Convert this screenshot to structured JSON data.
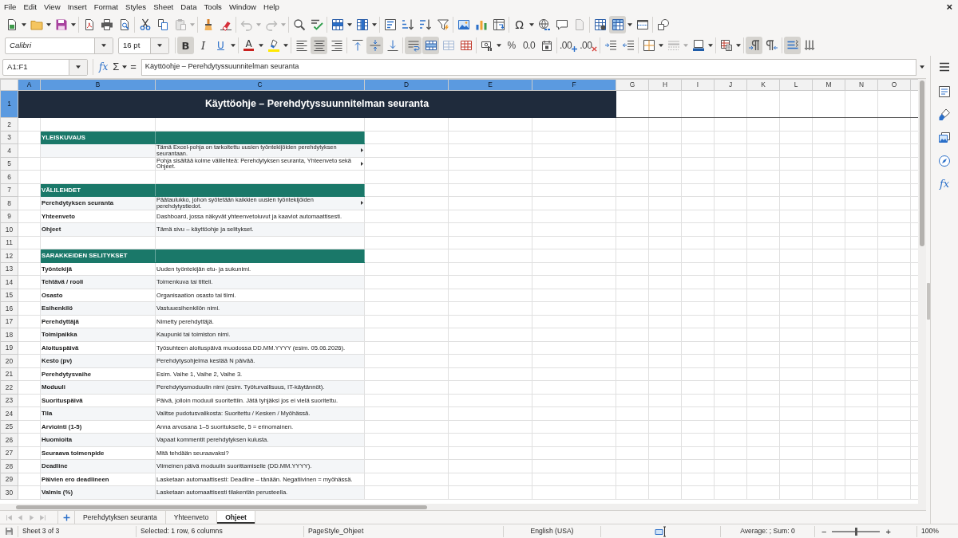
{
  "menu_bar": {
    "items": [
      "File",
      "Edit",
      "View",
      "Insert",
      "Format",
      "Styles",
      "Sheet",
      "Data",
      "Tools",
      "Window",
      "Help"
    ],
    "close": "×"
  },
  "standard_toolbar": {
    "groups": [
      [
        {
          "kind": "new",
          "dropdown": true,
          "pressed": false,
          "disabled": false
        },
        {
          "kind": "open",
          "dropdown": true,
          "pressed": false,
          "disabled": false
        },
        {
          "kind": "save",
          "dropdown": true,
          "pressed": false,
          "disabled": false
        }
      ],
      [
        {
          "kind": "pdf",
          "pressed": false,
          "disabled": false
        },
        {
          "kind": "print",
          "pressed": false,
          "disabled": false
        },
        {
          "kind": "preview",
          "pressed": false,
          "disabled": false
        }
      ],
      [
        {
          "kind": "cut",
          "pressed": false,
          "disabled": false
        },
        {
          "kind": "copy",
          "pressed": false,
          "disabled": false
        },
        {
          "kind": "paste",
          "dropdown": true,
          "pressed": false,
          "disabled": true
        }
      ],
      [
        {
          "kind": "clone",
          "pressed": false,
          "disabled": false
        },
        {
          "kind": "clear",
          "pressed": false,
          "disabled": false
        }
      ],
      [
        {
          "kind": "undo",
          "dropdown": true,
          "pressed": false,
          "disabled": true
        },
        {
          "kind": "redo",
          "dropdown": true,
          "pressed": false,
          "disabled": true
        }
      ],
      [
        {
          "kind": "find",
          "pressed": false,
          "disabled": false
        },
        {
          "kind": "spelling",
          "pressed": false,
          "disabled": false
        }
      ],
      [
        {
          "kind": "row",
          "dropdown": true,
          "pressed": false,
          "disabled": false
        },
        {
          "kind": "column",
          "dropdown": true,
          "pressed": false,
          "disabled": false
        }
      ],
      [
        {
          "kind": "sort",
          "pressed": false,
          "disabled": false
        },
        {
          "kind": "sortasc",
          "pressed": false,
          "disabled": false
        },
        {
          "kind": "sortdesc",
          "pressed": false,
          "disabled": false
        },
        {
          "kind": "filter",
          "pressed": false,
          "disabled": false
        }
      ],
      [
        {
          "kind": "image",
          "pressed": false,
          "disabled": false
        },
        {
          "kind": "chart",
          "pressed": false,
          "disabled": false
        },
        {
          "kind": "pivot",
          "pressed": false,
          "disabled": false
        }
      ],
      [
        {
          "kind": "special",
          "text": "Ω",
          "dropdown": true,
          "pressed": false,
          "disabled": false
        },
        {
          "kind": "link",
          "pressed": false,
          "disabled": false
        },
        {
          "kind": "comment",
          "pressed": false,
          "disabled": false
        },
        {
          "kind": "headerfooter",
          "pressed": false,
          "disabled": true
        }
      ],
      [
        {
          "kind": "printarea",
          "pressed": false,
          "disabled": false
        },
        {
          "kind": "freeze",
          "dropdown": true,
          "pressed": true,
          "disabled": false
        },
        {
          "kind": "split",
          "pressed": false,
          "disabled": false
        }
      ],
      [
        {
          "kind": "draw",
          "pressed": false,
          "disabled": false
        }
      ]
    ]
  },
  "formatting_toolbar": {
    "font_name": "Calibri",
    "font_size": "16 pt",
    "groups": [
      [
        {
          "kind": "bold",
          "text": "B",
          "pressed": true,
          "disabled": false
        },
        {
          "kind": "italic",
          "text": "I",
          "pressed": false,
          "disabled": false
        },
        {
          "kind": "underline",
          "text": "U",
          "dropdown": true,
          "pressed": false,
          "disabled": false
        }
      ],
      [
        {
          "kind": "fontcolor",
          "text": "A",
          "dropdown": true,
          "pressed": false,
          "disabled": false
        },
        {
          "kind": "highlight",
          "dropdown": true,
          "pressed": false,
          "disabled": false
        }
      ],
      [
        {
          "kind": "alignleft",
          "pressed": false,
          "disabled": false
        },
        {
          "kind": "aligncenter",
          "pressed": true,
          "disabled": false
        },
        {
          "kind": "alignright",
          "pressed": false,
          "disabled": false
        }
      ],
      [
        {
          "kind": "aligntop",
          "pressed": false,
          "disabled": false
        },
        {
          "kind": "alignmiddle",
          "pressed": true,
          "disabled": false
        },
        {
          "kind": "alignbottom",
          "pressed": false,
          "disabled": false
        }
      ],
      [
        {
          "kind": "wrap",
          "pressed": true,
          "disabled": false
        },
        {
          "kind": "mergecenter",
          "pressed": true,
          "disabled": false
        },
        {
          "kind": "merge",
          "pressed": false,
          "disabled": true
        },
        {
          "kind": "unmerge",
          "pressed": false,
          "disabled": false
        }
      ],
      [
        {
          "kind": "currency",
          "dropdown": true,
          "pressed": false,
          "disabled": false
        },
        {
          "kind": "percent",
          "text": "%",
          "pressed": false,
          "disabled": false
        },
        {
          "kind": "number",
          "text": "0.0",
          "pressed": false,
          "disabled": false
        },
        {
          "kind": "date",
          "pressed": false,
          "disabled": false
        }
      ],
      [
        {
          "kind": "adddec",
          "text": ".00",
          "pressed": false,
          "disabled": false
        },
        {
          "kind": "deldec",
          "text": ".00",
          "pressed": false,
          "disabled": false
        }
      ],
      [
        {
          "kind": "indent",
          "pressed": false,
          "disabled": false
        },
        {
          "kind": "outdent",
          "pressed": false,
          "disabled": false
        }
      ],
      [
        {
          "kind": "borders",
          "dropdown": true,
          "pressed": false,
          "disabled": false
        },
        {
          "kind": "borderstyle",
          "dropdown": true,
          "pressed": false,
          "disabled": true
        },
        {
          "kind": "bordercolor",
          "dropdown": true,
          "pressed": false,
          "disabled": false
        }
      ],
      [
        {
          "kind": "conditional",
          "dropdown": true,
          "pressed": false,
          "disabled": false
        }
      ],
      [
        {
          "kind": "ltr",
          "pressed": true,
          "disabled": false
        },
        {
          "kind": "rtl",
          "pressed": false,
          "disabled": false
        }
      ],
      [
        {
          "kind": "horizontal",
          "pressed": true,
          "disabled": false
        },
        {
          "kind": "vertical",
          "pressed": false,
          "disabled": false
        }
      ]
    ]
  },
  "formula_bar": {
    "name_box": "A1:F1",
    "function_wizard": "fx",
    "sum": "Σ",
    "equals": "=",
    "content": "Käyttöohje – Perehdytyssuunnitelman seuranta"
  },
  "sidebar": {
    "functions": "fx"
  },
  "columns": [
    {
      "label": "A",
      "selected": true
    },
    {
      "label": "B",
      "selected": true
    },
    {
      "label": "C",
      "selected": true
    },
    {
      "label": "D",
      "selected": true
    },
    {
      "label": "E",
      "selected": true
    },
    {
      "label": "F",
      "selected": true
    },
    {
      "label": "G",
      "selected": false
    },
    {
      "label": "H",
      "selected": false
    },
    {
      "label": "I",
      "selected": false
    },
    {
      "label": "J",
      "selected": false
    },
    {
      "label": "K",
      "selected": false
    },
    {
      "label": "L",
      "selected": false
    },
    {
      "label": "M",
      "selected": false
    },
    {
      "label": "N",
      "selected": false
    },
    {
      "label": "O",
      "selected": false
    }
  ],
  "rows": [
    {
      "number": "1",
      "selected": true,
      "kind": "title",
      "text": "Käyttöohje – Perehdytyssuunnitelman seuranta"
    },
    {
      "number": "2",
      "selected": false,
      "kind": "blank"
    },
    {
      "number": "3",
      "selected": false,
      "kind": "section",
      "label": "YLEISKUVAUS"
    },
    {
      "number": "4",
      "selected": false,
      "kind": "entry",
      "description": "Tämä Excel-pohja on tarkoitettu uusien työntekijöiden perehdytyksen seurantaan.",
      "overflow": true
    },
    {
      "number": "5",
      "selected": false,
      "kind": "entry",
      "description": "Pohja sisältää kolme välilehteä: Perehdytyksen seuranta, Yhteenveto sekä Ohjeet.",
      "overflow": true
    },
    {
      "number": "6",
      "selected": false,
      "kind": "blank"
    },
    {
      "number": "7",
      "selected": false,
      "kind": "section",
      "label": "VÄLILEHDET"
    },
    {
      "number": "8",
      "selected": false,
      "kind": "entry",
      "term": "Perehdytyksen seuranta",
      "description": "Päätaulukko, johon syötetään kaikkien uusien työntekijöiden perehdytystiedot.",
      "overflow": true
    },
    {
      "number": "9",
      "selected": false,
      "kind": "entry",
      "term": "Yhteenveto",
      "description": "Dashboard, jossa näkyvät yhteenvetoluvut ja kaaviot automaattisesti.",
      "overflow": false
    },
    {
      "number": "10",
      "selected": false,
      "kind": "entry",
      "term": "Ohjeet",
      "description": "Tämä sivu – käyttöohje ja selitykset.",
      "overflow": false
    },
    {
      "number": "11",
      "selected": false,
      "kind": "blank"
    },
    {
      "number": "12",
      "selected": false,
      "kind": "section",
      "label": "SARAKKEIDEN SELITYKSET"
    },
    {
      "number": "13",
      "selected": false,
      "kind": "entry",
      "term": "Työntekijä",
      "description": "Uuden työntekijän etu- ja sukunimi.",
      "overflow": false
    },
    {
      "number": "14",
      "selected": false,
      "kind": "entry",
      "term": "Tehtävä / rooli",
      "description": "Toimenkuva tai titteli.",
      "overflow": false
    },
    {
      "number": "15",
      "selected": false,
      "kind": "entry",
      "term": "Osasto",
      "description": "Organisaation osasto tai tiimi.",
      "overflow": false
    },
    {
      "number": "16",
      "selected": false,
      "kind": "entry",
      "term": "Esihenkilö",
      "description": "Vastuuesihenkilön nimi.",
      "overflow": false
    },
    {
      "number": "17",
      "selected": false,
      "kind": "entry",
      "term": "Perehdyttäjä",
      "description": "Nimetty perehdyttäjä.",
      "overflow": false
    },
    {
      "number": "18",
      "selected": false,
      "kind": "entry",
      "term": "Toimipaikka",
      "description": "Kaupunki tai toimiston nimi.",
      "overflow": false
    },
    {
      "number": "19",
      "selected": false,
      "kind": "entry",
      "term": "Aloituspäivä",
      "description": "Työsuhteen aloituspäivä muodossa DD.MM.YYYY (esim. 05.06.2026).",
      "overflow": false
    },
    {
      "number": "20",
      "selected": false,
      "kind": "entry",
      "term": "Kesto (pv)",
      "description": "Perehdytysohjelma kestää N päivää.",
      "overflow": false
    },
    {
      "number": "21",
      "selected": false,
      "kind": "entry",
      "term": "Perehdytysvaihe",
      "description": "Esim. Vaihe 1, Vaihe 2, Vaihe 3.",
      "overflow": false
    },
    {
      "number": "22",
      "selected": false,
      "kind": "entry",
      "term": "Moduuli",
      "description": "Perehdytysmoduulin nimi (esim. Työturvallisuus, IT-käytännöt).",
      "overflow": false
    },
    {
      "number": "23",
      "selected": false,
      "kind": "entry",
      "term": "Suorituspäivä",
      "description": "Päivä, jolloin moduuli suoritettiin. Jätä tyhjäksi jos ei vielä suoritettu.",
      "overflow": false
    },
    {
      "number": "24",
      "selected": false,
      "kind": "entry",
      "term": "Tila",
      "description": "Valitse pudotusvalikosta: Suoritettu / Kesken / Myöhässä.",
      "overflow": false
    },
    {
      "number": "25",
      "selected": false,
      "kind": "entry",
      "term": "Arviointi (1-5)",
      "description": "Anna arvosana 1–5 suoritukselle, 5 = erinomainen.",
      "overflow": false
    },
    {
      "number": "26",
      "selected": false,
      "kind": "entry",
      "term": "Huomioita",
      "description": "Vapaat kommentit perehdytyksen kulusta.",
      "overflow": false
    },
    {
      "number": "27",
      "selected": false,
      "kind": "entry",
      "term": "Seuraava toimenpide",
      "description": "Mitä tehdään seuraavaksi?",
      "overflow": false
    },
    {
      "number": "28",
      "selected": false,
      "kind": "entry",
      "term": "Deadline",
      "description": "Viimeinen päivä moduulin suorittamiselle (DD.MM.YYYY).",
      "overflow": false
    },
    {
      "number": "29",
      "selected": false,
      "kind": "entry",
      "term": "Päivien ero deadlineen",
      "description": "Lasketaan automaattisesti: Deadline – tänään. Negatiivinen = myöhässä.",
      "overflow": false
    },
    {
      "number": "30",
      "selected": false,
      "kind": "entry",
      "term": "Valmis (%)",
      "description": "Lasketaan automaattisesti tilakentän perusteella.",
      "overflow": false
    }
  ],
  "sheet_bar": {
    "navigation_disabled": true,
    "tabs": [
      {
        "label": "Perehdytyksen seuranta",
        "selected": false
      },
      {
        "label": "Yhteenveto",
        "selected": false
      },
      {
        "label": "Ohjeet",
        "selected": true
      }
    ]
  },
  "status_bar": {
    "sheet": "Sheet 3 of 3",
    "selection": "Selected: 1 row, 6 columns",
    "page_style": "PageStyle_Ohjeet",
    "language": "English (USA)",
    "summary": "Average: ; Sum: 0",
    "zoom_out": "−",
    "zoom_in": "+",
    "zoom": {
      "level": 0.5,
      "reading": "100%"
    }
  }
}
